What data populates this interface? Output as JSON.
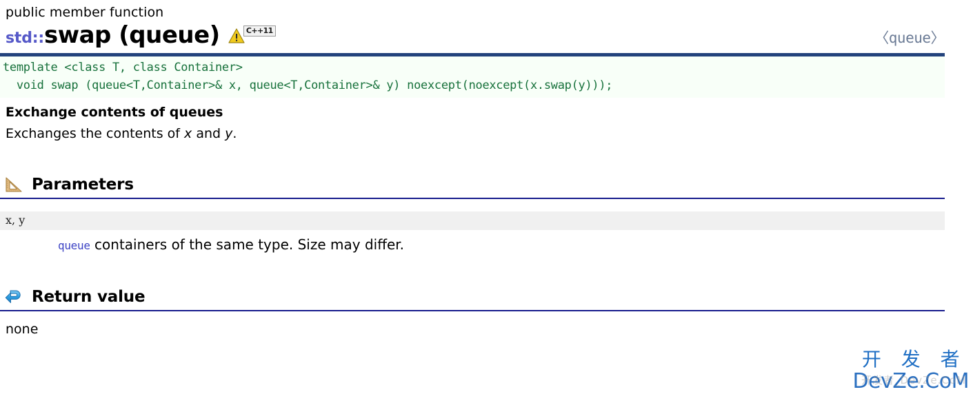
{
  "header": {
    "kind": "public member function",
    "namespace": "std::",
    "name": "swap (queue)",
    "std_badge": "C++11",
    "warning_icon": "warning-triangle-icon",
    "include_header": "〈queue〉"
  },
  "signature": {
    "line1": "template <class T, class Container>",
    "line2": "  void swap (queue<T,Container>& x, queue<T,Container>& y) noexcept(noexcept(x.swap(y)));"
  },
  "description": {
    "title": "Exchange contents of queues",
    "text_before": "Exchanges the contents of ",
    "param_x": "x",
    "text_middle": " and ",
    "param_y": "y",
    "text_after": "."
  },
  "sections": {
    "parameters": {
      "icon": "ruler-triangle-icon",
      "title": "Parameters",
      "rows": [
        {
          "key": "x, y",
          "link": "queue",
          "desc": " containers of the same type. Size may differ."
        }
      ]
    },
    "return_value": {
      "icon": "return-arrow-icon",
      "title": "Return value",
      "text": "none"
    }
  },
  "watermark": {
    "cn": "开 发 者",
    "en": "DevZe.CoM",
    "ghost": "开发者_DevZe.CoM"
  },
  "colors": {
    "navy_rule": "#23437c",
    "section_rule": "#151a8c",
    "code_text": "#17713b",
    "code_bg": "#f8fff8",
    "namespace": "#5558c8",
    "link": "#3b42c4",
    "header_file": "#6b7b95",
    "param_bar": "#f0f0f0",
    "watermark": "#2a6fc0"
  }
}
